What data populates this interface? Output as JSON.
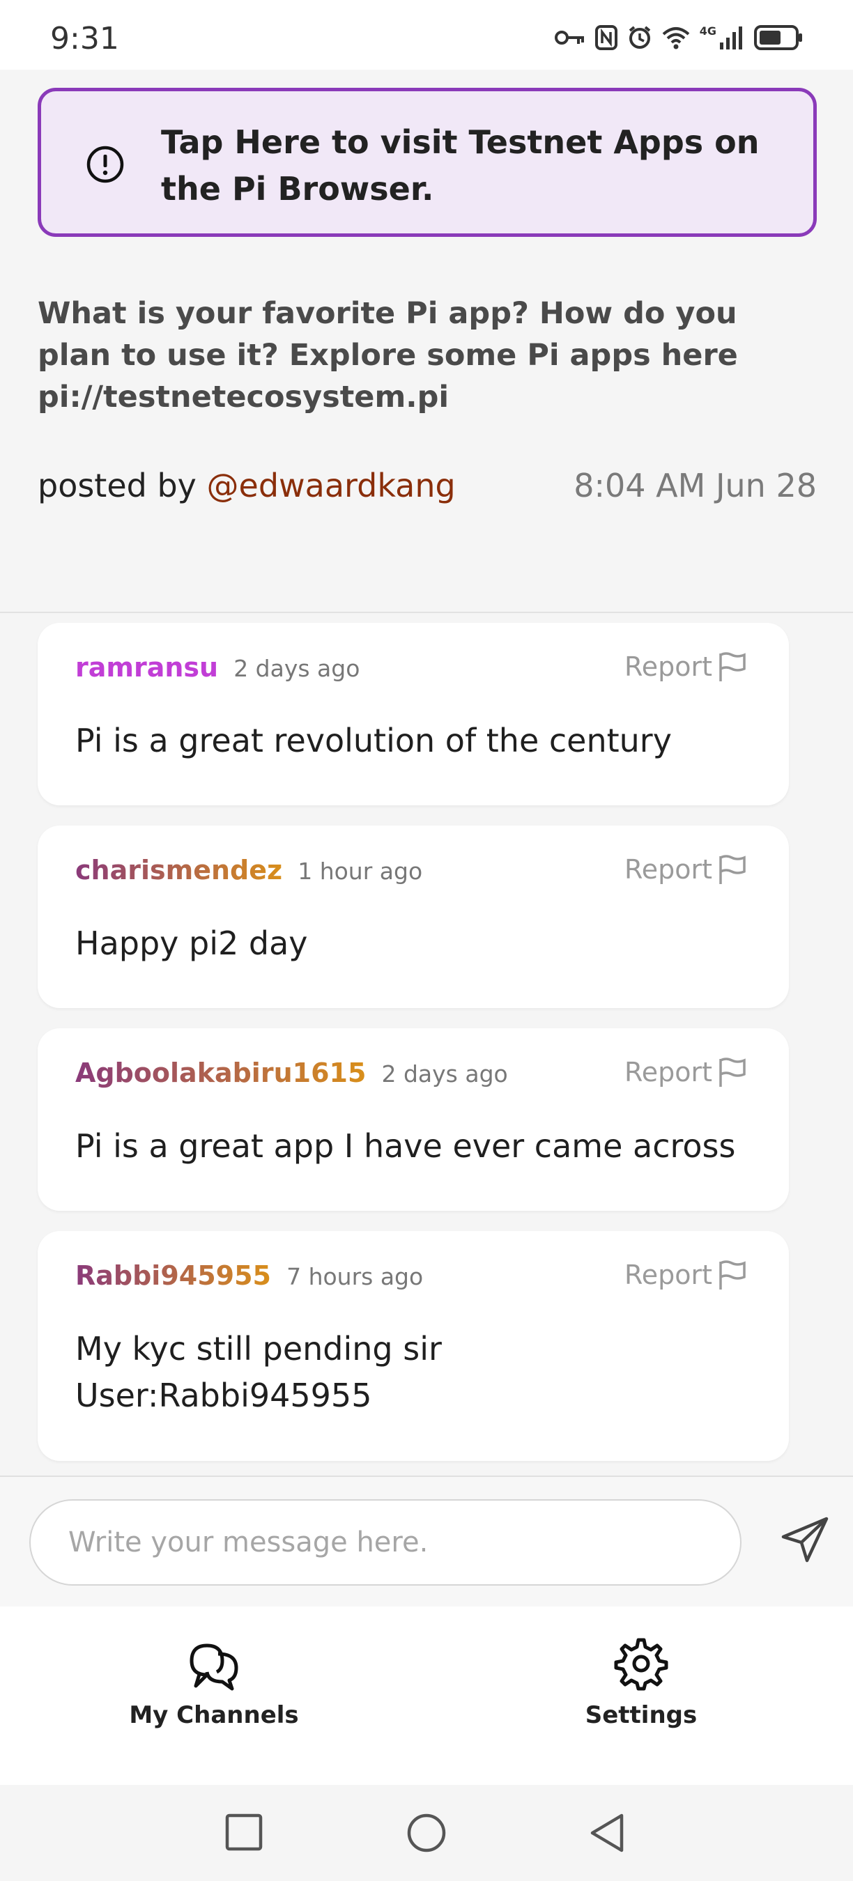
{
  "status_bar": {
    "time": "9:31",
    "network": "4G"
  },
  "banner": {
    "text": "Tap Here to visit Testnet Apps on the Pi Browser."
  },
  "post": {
    "body": "What is your favorite Pi app? How do you plan to use it? Explore some Pi apps here pi://testnetecosystem.pi",
    "posted_by_prefix": "posted by",
    "author": "@edwaardkang",
    "time": "8:04 AM Jun 28"
  },
  "comments": [
    {
      "user": "ramransu",
      "ago": "2 days ago",
      "text": "Pi is a great revolution of the century",
      "report": "Report",
      "user_color": "#c13ed6"
    },
    {
      "user": "charismendez",
      "ago": "1 hour ago",
      "text": "Happy pi2 day",
      "report": "Report",
      "user_color": "#9c5a2e"
    },
    {
      "user": "Agboolakabiru1615",
      "ago": "2 days ago",
      "text": "Pi is a great app I have ever came across",
      "report": "Report",
      "user_color": "#a25a3a"
    },
    {
      "user": "Rabbi945955",
      "ago": "7 hours ago",
      "text": "My kyc still pending sir\nUser:Rabbi945955",
      "report": "Report",
      "user_color": "#95503f"
    }
  ],
  "composer": {
    "placeholder": "Write your message here."
  },
  "nav": {
    "my_channels": "My Channels",
    "settings": "Settings"
  },
  "colors": {
    "accent": "#8a3ab9",
    "banner_bg": "#f1e8f7",
    "author": "#8a2e0a"
  }
}
